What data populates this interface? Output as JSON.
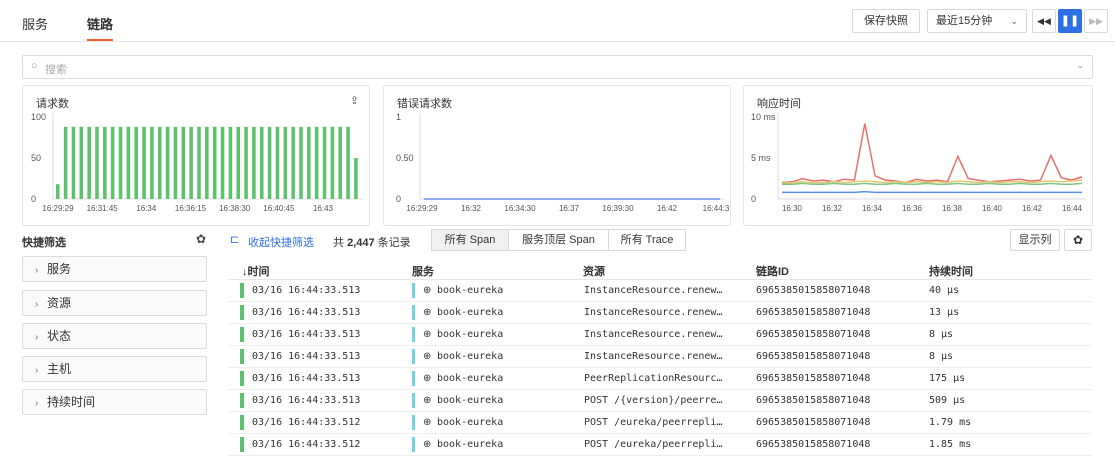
{
  "tabs": [
    "服务",
    "链路"
  ],
  "toolbar": {
    "save_snapshot": "保存快照",
    "time_range": "最近15分钟"
  },
  "search": {
    "placeholder": "搜索"
  },
  "charts": [
    {
      "title": "请求数",
      "type": "bar",
      "yticks": [
        "100",
        "50",
        "0"
      ],
      "xticks": [
        "16:29:29",
        "16:31:45",
        "16:34",
        "16:36:15",
        "16:38:30",
        "16:40:45",
        "16:43"
      ],
      "ylim": [
        0,
        100
      ],
      "color": "#5cc26b",
      "values": [
        18,
        88,
        88,
        88,
        88,
        88,
        88,
        88,
        88,
        88,
        88,
        88,
        88,
        88,
        88,
        88,
        88,
        88,
        88,
        88,
        88,
        88,
        88,
        88,
        88,
        88,
        88,
        88,
        88,
        88,
        88,
        88,
        88,
        88,
        88,
        88,
        88,
        88,
        50
      ]
    },
    {
      "title": "错误请求数",
      "type": "line",
      "yticks": [
        "1",
        "0.50",
        "0"
      ],
      "xticks": [
        "16:29:29",
        "16:32",
        "16:34:30",
        "16:37",
        "16:39:30",
        "16:42",
        "16:44:3"
      ],
      "ylim": [
        0,
        1
      ],
      "series": [
        {
          "color": "#6a8ff0",
          "values": [
            0,
            0,
            0,
            0,
            0,
            0,
            0,
            0,
            0,
            0,
            0,
            0,
            0,
            0,
            0,
            0,
            0,
            0,
            0,
            0,
            0,
            0,
            0,
            0,
            0,
            0,
            0,
            0,
            0,
            0
          ]
        }
      ]
    },
    {
      "title": "响应时间",
      "type": "line",
      "yticks": [
        "10 ms",
        "5 ms",
        "0"
      ],
      "xticks": [
        "16:30",
        "16:32",
        "16:34",
        "16:36",
        "16:38",
        "16:40",
        "16:42",
        "16:44"
      ],
      "ylim": [
        0,
        10
      ],
      "series": [
        {
          "color": "#e86f6f",
          "values": [
            2.0,
            2.1,
            2.5,
            2.2,
            2.3,
            2.1,
            2.4,
            2.3,
            9.2,
            2.8,
            2.3,
            2.2,
            2.0,
            2.4,
            2.2,
            2.3,
            2.1,
            5.2,
            2.5,
            2.3,
            2.1,
            2.2,
            2.3,
            2.4,
            2.2,
            2.3,
            5.3,
            2.6,
            2.3,
            2.7
          ]
        },
        {
          "color": "#e8c86a",
          "values": [
            1.9,
            2.0,
            2.1,
            2.0,
            2.0,
            2.1,
            2.0,
            2.1,
            2.2,
            2.1,
            2.0,
            2.1,
            2.0,
            2.1,
            2.0,
            2.1,
            2.0,
            2.2,
            2.1,
            2.0,
            2.1,
            2.0,
            2.1,
            2.1,
            2.0,
            2.1,
            2.2,
            2.1,
            2.2,
            2.3
          ]
        },
        {
          "color": "#7cc68a",
          "values": [
            1.8,
            1.8,
            1.9,
            1.8,
            1.8,
            1.9,
            1.8,
            1.8,
            1.9,
            1.8,
            1.8,
            1.9,
            1.8,
            1.8,
            1.9,
            1.8,
            1.8,
            1.9,
            1.8,
            1.8,
            1.9,
            1.8,
            1.8,
            1.9,
            1.8,
            1.8,
            1.9,
            1.8,
            1.8,
            1.9
          ]
        },
        {
          "color": "#5b8ff0",
          "values": [
            0.8,
            0.8,
            0.8,
            0.8,
            0.8,
            0.8,
            0.8,
            0.8,
            0.9,
            0.8,
            0.8,
            0.8,
            0.8,
            0.8,
            0.8,
            0.8,
            0.8,
            0.8,
            0.8,
            0.8,
            0.8,
            0.8,
            0.8,
            0.8,
            0.8,
            0.8,
            0.8,
            0.8,
            0.8,
            0.8
          ]
        }
      ]
    }
  ],
  "filters": {
    "title": "快捷筛选",
    "items": [
      "服务",
      "资源",
      "状态",
      "主机",
      "持续时间"
    ]
  },
  "list": {
    "collapse_label": "收起快捷筛选",
    "total_prefix": "共",
    "total_count": "2,447",
    "total_suffix": "条记录",
    "segments": [
      "所有 Span",
      "服务顶层 Span",
      "所有 Trace"
    ],
    "show_columns": "显示列",
    "columns": [
      "↓时间",
      "服务",
      "资源",
      "链路ID",
      "持续时间"
    ],
    "rows": [
      [
        "03/16 16:44:33.513",
        "book-eureka",
        "InstanceResource.renew…",
        "6965385015858071048",
        "40 µs"
      ],
      [
        "03/16 16:44:33.513",
        "book-eureka",
        "InstanceResource.renew…",
        "6965385015858071048",
        "13 µs"
      ],
      [
        "03/16 16:44:33.513",
        "book-eureka",
        "InstanceResource.renew…",
        "6965385015858071048",
        "8 µs"
      ],
      [
        "03/16 16:44:33.513",
        "book-eureka",
        "InstanceResource.renew…",
        "6965385015858071048",
        "8 µs"
      ],
      [
        "03/16 16:44:33.513",
        "book-eureka",
        "PeerReplicationResourc…",
        "6965385015858071048",
        "175 µs"
      ],
      [
        "03/16 16:44:33.513",
        "book-eureka",
        "POST /{version}/peerre…",
        "6965385015858071048",
        "509 µs"
      ],
      [
        "03/16 16:44:33.512",
        "book-eureka",
        "POST /eureka/peerrepli…",
        "6965385015858071048",
        "1.79 ms"
      ],
      [
        "03/16 16:44:33.512",
        "book-eureka",
        "POST /eureka/peerrepli…",
        "6965385015858071048",
        "1.85 ms"
      ]
    ]
  }
}
